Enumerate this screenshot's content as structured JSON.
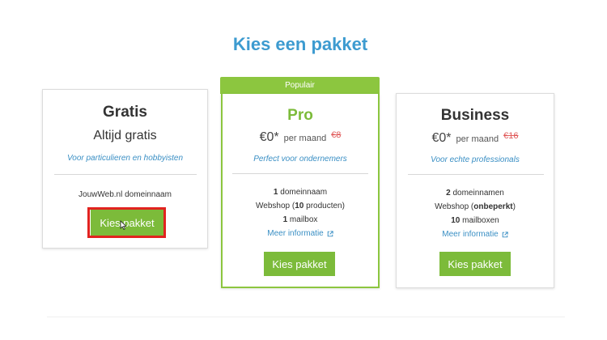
{
  "page": {
    "title": "Kies een pakket"
  },
  "plans": {
    "gratis": {
      "name": "Gratis",
      "price_label": "Altijd gratis",
      "tagline": "Voor particulieren en hobbyisten",
      "feature_1": "JouwWeb.nl domeinnaam",
      "button": "Kies pakket"
    },
    "pro": {
      "banner": "Populair",
      "name": "Pro",
      "price": "€0*",
      "per": "per maand",
      "old_price": "€8",
      "tagline": "Perfect voor ondernemers",
      "f1_bold": "1",
      "f1_text": " domeinnaam",
      "f2_pre": "Webshop (",
      "f2_bold": "10",
      "f2_post": " producten)",
      "f3_bold": "1",
      "f3_text": " mailbox",
      "more_info": "Meer informatie",
      "button": "Kies pakket"
    },
    "business": {
      "name": "Business",
      "price": "€0*",
      "per": "per maand",
      "old_price": "€16",
      "tagline": "Voor echte professionals",
      "f1_bold": "2",
      "f1_text": " domeinnamen",
      "f2_pre": "Webshop (",
      "f2_bold": "onbeperkt",
      "f2_post": ")",
      "f3_bold": "10",
      "f3_text": " mailboxen",
      "more_info": "Meer informatie",
      "button": "Kies pakket"
    }
  },
  "colors": {
    "title_blue": "#3d9bd0",
    "green": "#8cc63f",
    "button_green": "#7cbb3a",
    "old_price_red": "#e05a5a",
    "highlight_red": "#e1231f"
  },
  "icons": {
    "external_link": "external-link-icon",
    "cursor": "mouse-pointer-icon"
  }
}
